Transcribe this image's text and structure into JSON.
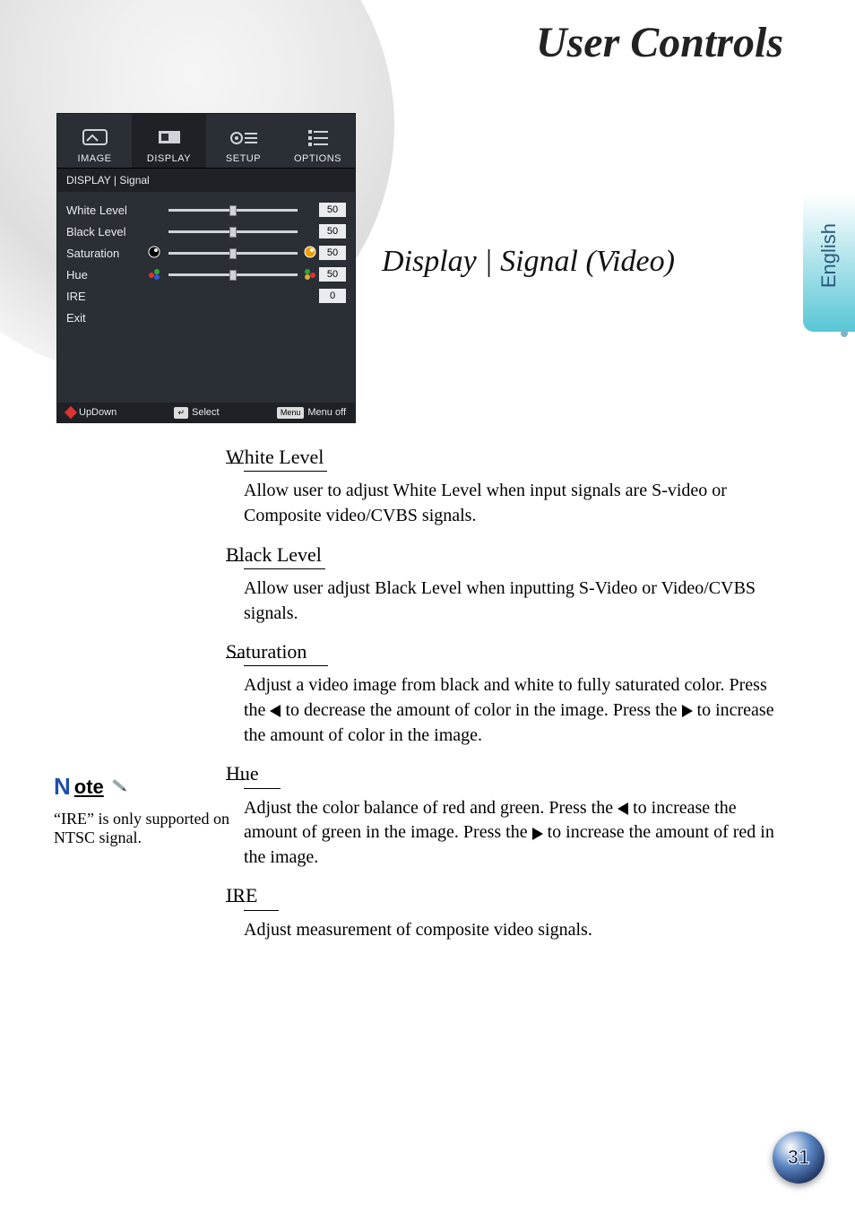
{
  "page_title": "User Controls",
  "subheader": "Display | Signal (Video)",
  "language_tab": "English",
  "page_number": "31",
  "osd": {
    "tabs": [
      "IMAGE",
      "DISPLAY",
      "SETUP",
      "OPTIONS"
    ],
    "selected_tab_index": 1,
    "breadcrumb": "DISPLAY | Signal",
    "rows": [
      {
        "label": "White Level",
        "value": "50",
        "slider": true
      },
      {
        "label": "Black Level",
        "value": "50",
        "slider": true
      },
      {
        "label": "Saturation",
        "value": "50",
        "slider": true,
        "color_icons": "sat"
      },
      {
        "label": "Hue",
        "value": "50",
        "slider": true,
        "color_icons": "hue"
      },
      {
        "label": "IRE",
        "value": "0",
        "slider": false
      },
      {
        "label": "Exit",
        "value": "",
        "slider": false
      }
    ],
    "footer": {
      "updown": "UpDown",
      "select": "Select",
      "menu_key": "Menu",
      "menu_off": "Menu off"
    }
  },
  "sections": [
    {
      "heading": "White Level",
      "body_before": "Allow user to adjust White Level when input signals are S-video or Composite video/CVBS signals."
    },
    {
      "heading": "Black Level",
      "body_before": "Allow user adjust Black Level when inputting S-Video or Video/CVBS signals."
    },
    {
      "heading": "Saturation",
      "body_before": "Adjust a video image from black and white to fully saturated color. Press the ",
      "mid": " to decrease the amount of color in the image. Press the ",
      "body_after": " to increase the amount of color in the image."
    },
    {
      "heading": "Hue",
      "body_before": "Adjust the color balance of red and green. Press the ",
      "mid": " to increase the amount of green in the image. Press the ",
      "body_after": " to increase the amount of red in the image."
    },
    {
      "heading": "IRE",
      "body_before": "Adjust measurement of composite video signals."
    }
  ],
  "note": {
    "label_n": "N",
    "label_ote": "ote",
    "text": "“IRE” is only supported on NTSC signal."
  }
}
